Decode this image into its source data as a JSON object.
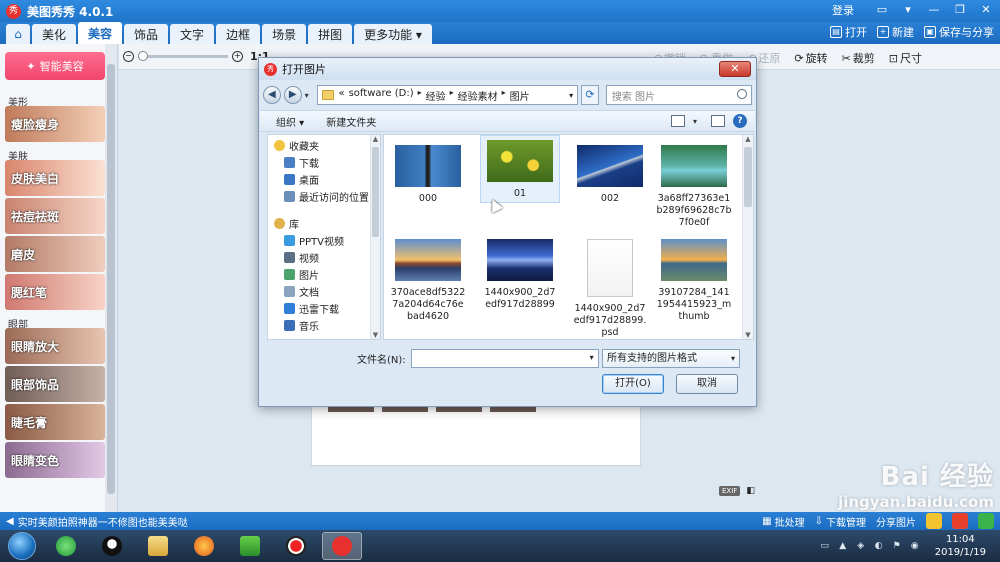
{
  "app": {
    "title": "美图秀秀 4.0.1",
    "login": "登录",
    "logo_char": "秀"
  },
  "nav": {
    "tabs": [
      "美化",
      "美容",
      "饰品",
      "文字",
      "边框",
      "场景",
      "拼图",
      "更多功能 ▾"
    ],
    "active_index": 1,
    "actions": [
      "打开",
      "新建",
      "保存与分享"
    ]
  },
  "sidebar": {
    "smart_button": "智能美容",
    "sections": [
      {
        "label": "美形",
        "items": [
          "瘦脸瘦身"
        ]
      },
      {
        "label": "美肤",
        "items": [
          "皮肤美白",
          "祛痘祛斑",
          "磨皮",
          "腮红笔"
        ]
      },
      {
        "label": "眼部",
        "items": [
          "眼睛放大",
          "眼部饰品",
          "睫毛膏",
          "眼睛变色"
        ]
      }
    ]
  },
  "canvas": {
    "zoom_ratio": "1:1",
    "zoom_level": 0,
    "tools": [
      "撤销",
      "重做",
      "还原",
      "旋转",
      "裁剪",
      "尺寸"
    ],
    "exif": "EXIF"
  },
  "status_bar": {
    "tip": "实时美颜拍照神器一不修图也能美美哒",
    "items": [
      "批处理",
      "下载管理",
      "分享图片"
    ]
  },
  "taskbar": {
    "time": "11:04",
    "date": "2019/1/19",
    "tray_glyphs": [
      "▭",
      "▲",
      "◈",
      "◐",
      "⚑",
      "◉"
    ]
  },
  "dialog": {
    "title": "打开图片",
    "close": "✕",
    "breadcrumb": [
      "«",
      "software (D:)",
      "经验",
      "经验素材",
      "图片"
    ],
    "breadcrumb_sep": "▸",
    "search_placeholder": "搜索 图片",
    "commands": [
      "组织 ▾",
      "新建文件夹"
    ],
    "nav_tree": [
      {
        "label": "收藏夹",
        "icon": "star-icon",
        "color": "#f2c33c",
        "group": true
      },
      {
        "label": "下载",
        "icon": "download-folder-icon",
        "color": "#4a7fc4"
      },
      {
        "label": "桌面",
        "icon": "desktop-icon",
        "color": "#3a77c4"
      },
      {
        "label": "最近访问的位置",
        "icon": "recent-places-icon",
        "color": "#6b8fb8"
      },
      {
        "label": "库",
        "icon": "library-icon",
        "color": "#e2b34a",
        "group": true
      },
      {
        "label": "PPTV视频",
        "icon": "video-folder-icon",
        "color": "#3a9be0"
      },
      {
        "label": "视频",
        "icon": "video-library-icon",
        "color": "#5b6f84"
      },
      {
        "label": "图片",
        "icon": "pictures-library-icon",
        "color": "#4aa36a"
      },
      {
        "label": "文档",
        "icon": "documents-library-icon",
        "color": "#8aa4bf"
      },
      {
        "label": "迅雷下载",
        "icon": "xunlei-download-icon",
        "color": "#2f7fd8"
      },
      {
        "label": "音乐",
        "icon": "music-library-icon",
        "color": "#3a6fb8"
      }
    ],
    "files": [
      {
        "name": "000",
        "thumb": "person-photo",
        "selected": false
      },
      {
        "name": "01",
        "thumb": "flowers-photo",
        "selected": true
      },
      {
        "name": "002",
        "thumb": "fish-photo",
        "selected": false
      },
      {
        "name": "3a68ff27363e1b289f69628c7b7f0e0f",
        "thumb": "lake-photo",
        "selected": false
      },
      {
        "name": "370ace8df53227a204d64c76ebad4620",
        "thumb": "mountain-photo",
        "selected": false
      },
      {
        "name": "1440x900_2d7edf917d28899",
        "thumb": "sea-night-photo",
        "selected": false
      },
      {
        "name": "1440x900_2d7edf917d28899.psd",
        "thumb": "blank-document",
        "selected": false
      },
      {
        "name": "39107284_1411954415923_mthumb",
        "thumb": "sunset-photo",
        "selected": false
      }
    ],
    "filename_label": "文件名(N):",
    "filename_value": "",
    "filetype": "所有支持的图片格式",
    "open_button": "打开(O)",
    "cancel_button": "取消"
  },
  "watermark": {
    "big": "Bai 经验",
    "small": "jingyan.baidu.com"
  }
}
